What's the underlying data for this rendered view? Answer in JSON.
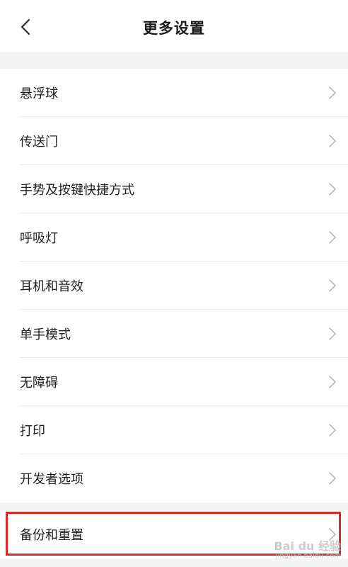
{
  "header": {
    "title": "更多设置",
    "back_icon": "chevron-left-icon"
  },
  "settings": {
    "items": [
      {
        "label": "悬浮球"
      },
      {
        "label": "传送门"
      },
      {
        "label": "手势及按键快捷方式"
      },
      {
        "label": "呼吸灯"
      },
      {
        "label": "耳机和音效"
      },
      {
        "label": "单手模式"
      },
      {
        "label": "无障碍"
      },
      {
        "label": "打印"
      },
      {
        "label": "开发者选项"
      }
    ],
    "backup_item": {
      "label": "备份和重置"
    }
  },
  "watermark": {
    "main": "Bai du 经验",
    "sub": "jingyan.baidu.com"
  },
  "colors": {
    "highlight_border": "#d12b2b",
    "section_gap": "#f4f4f4"
  }
}
